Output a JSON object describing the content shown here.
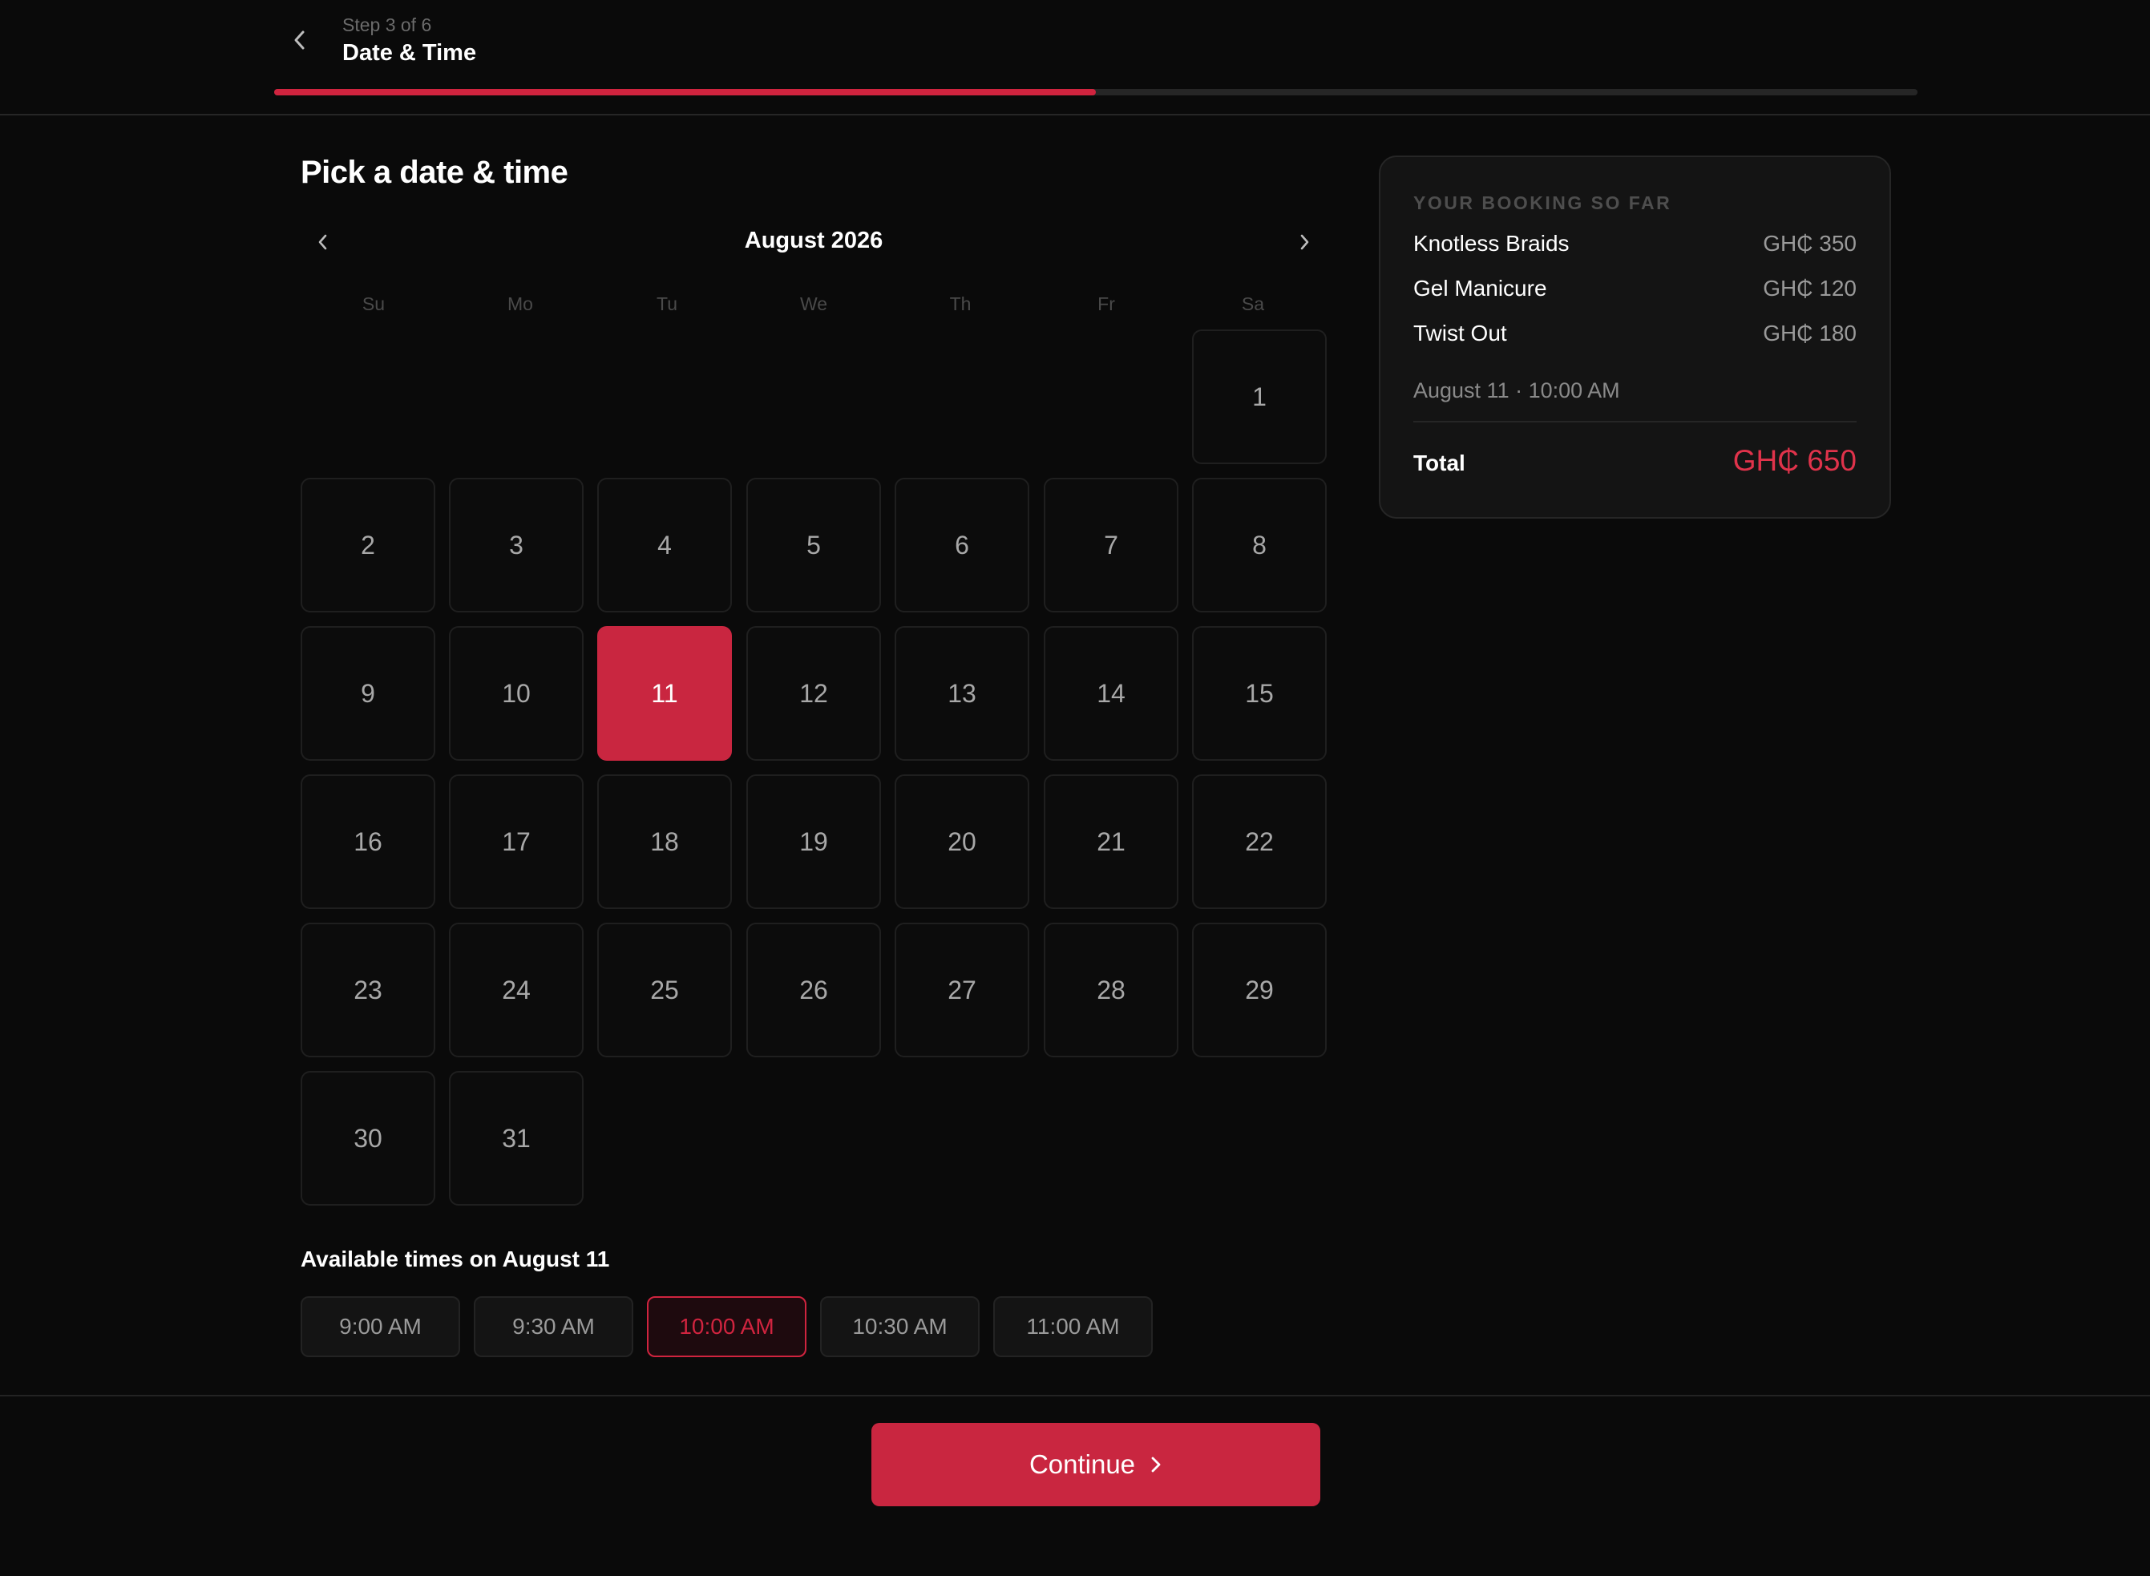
{
  "header": {
    "step_label": "Step 3 of 6",
    "title": "Date & Time",
    "progress_fraction": 0.5
  },
  "main": {
    "title": "Pick a date & time"
  },
  "calendar": {
    "month_label": "August 2026",
    "weekdays": [
      "Su",
      "Mo",
      "Tu",
      "We",
      "Th",
      "Fr",
      "Sa"
    ],
    "first_weekday_index": 6,
    "days_in_month": 31,
    "selected_day": 11
  },
  "times": {
    "title": "Available times on August 11",
    "slots": [
      "9:00 AM",
      "9:30 AM",
      "10:00 AM",
      "10:30 AM",
      "11:00 AM"
    ],
    "selected_index": 2
  },
  "summary": {
    "heading": "YOUR BOOKING SO FAR",
    "items": [
      {
        "name": "Knotless Braids",
        "price": "GH₵ 350"
      },
      {
        "name": "Gel Manicure",
        "price": "GH₵ 120"
      },
      {
        "name": "Twist Out",
        "price": "GH₵ 180"
      }
    ],
    "datetime": "August 11 · 10:00 AM",
    "total_label": "Total",
    "total_value": "GH₵ 650"
  },
  "footer": {
    "continue_label": "Continue"
  },
  "colors": {
    "accent": "#c92640",
    "background": "#0a0a0a"
  }
}
